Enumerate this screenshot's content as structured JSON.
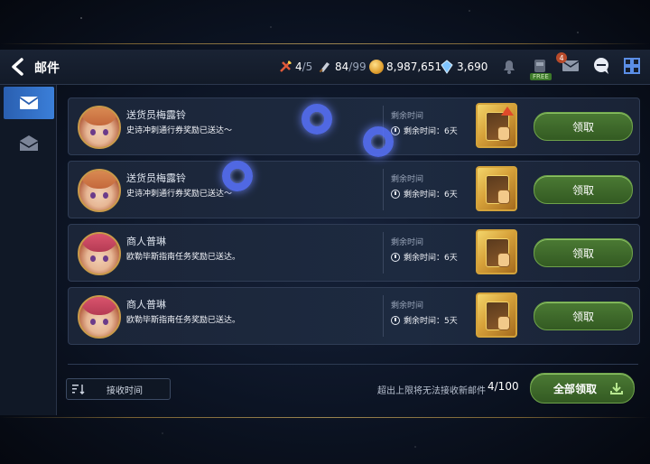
{
  "header": {
    "title": "邮件",
    "resources": [
      {
        "icon": "stamina-icon",
        "value": "4",
        "max": "/5"
      },
      {
        "icon": "ticket-icon",
        "value": "84",
        "max": "/99"
      },
      {
        "icon": "gold-coin-icon",
        "value": "8,987,651",
        "max": ""
      },
      {
        "icon": "crystal-icon",
        "value": "3,690",
        "max": ""
      }
    ],
    "free_badge": "FREE",
    "mail_badge": "4"
  },
  "sidebar": {
    "tabs": [
      {
        "icon": "envelope-icon",
        "active": true
      },
      {
        "icon": "open-envelope-icon",
        "active": false
      }
    ]
  },
  "mails": [
    {
      "sender": "送货员梅露铃",
      "message": "史诗冲刺通行券奖励已送达～",
      "remaining_label": "剩余时间",
      "remaining": "剩余时间：6天",
      "claim_label": "领取",
      "avatar": "orange",
      "has_arrow": true
    },
    {
      "sender": "送货员梅露铃",
      "message": "史诗冲刺通行券奖励已送达～",
      "remaining_label": "剩余时间",
      "remaining": "剩余时间：6天",
      "claim_label": "领取",
      "avatar": "orange",
      "has_arrow": false
    },
    {
      "sender": "商人普琳",
      "message": "欧勒毕斯指南任务奖励已送达。",
      "remaining_label": "剩余时间",
      "remaining": "剩余时间：6天",
      "claim_label": "领取",
      "avatar": "pink",
      "has_arrow": false
    },
    {
      "sender": "商人普琳",
      "message": "欧勒毕斯指南任务奖励已送达。",
      "remaining_label": "剩余时间",
      "remaining": "剩余时间：5天",
      "claim_label": "领取",
      "avatar": "pink",
      "has_arrow": false
    }
  ],
  "footer": {
    "sort_label": "接收时间",
    "limit_text": "超出上限将无法接收新邮件",
    "count": "4/100",
    "claim_all_label": "全部领取"
  },
  "colors": {
    "accent_blue": "#3b7fd9",
    "button_green": "#4b7a34",
    "gold_border": "#d3a33b",
    "touch_ring": "#5a74ff"
  }
}
